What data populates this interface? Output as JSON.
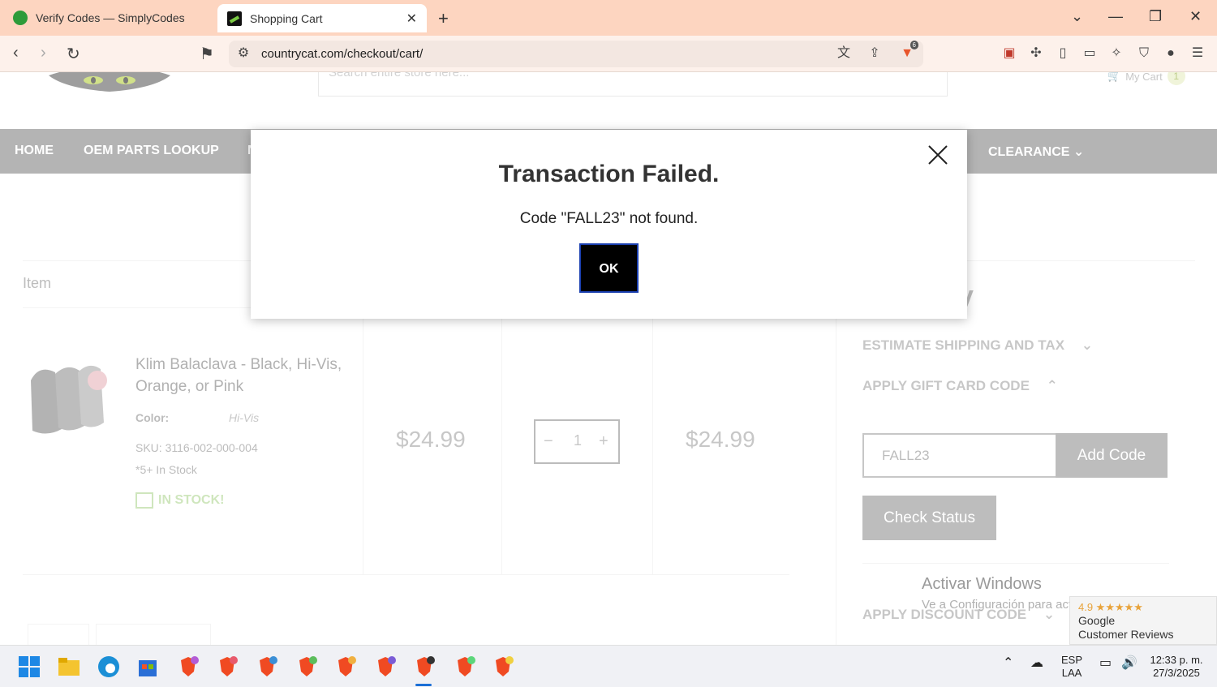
{
  "browser": {
    "tabs": [
      {
        "title": "Verify Codes — SimplyCodes",
        "active": false
      },
      {
        "title": "Shopping Cart",
        "active": true
      }
    ],
    "url": "countrycat.com/checkout/cart/",
    "brave_badge": "6"
  },
  "header": {
    "search_placeholder": "Search entire store here...",
    "cart_label": "My Cart",
    "cart_count": "1"
  },
  "nav": {
    "items": [
      "HOME",
      "OEM PARTS LOOKUP",
      "N",
      "CLEARANCE"
    ]
  },
  "cart": {
    "item_header": "Item",
    "product": {
      "name": "Klim Balaclava - Black, Hi-Vis, Orange, or Pink",
      "color_label": "Color:",
      "color_value": "Hi-Vis",
      "sku": "SKU: 3116-002-000-004",
      "stock_text": "*5+ In Stock",
      "badge": "IN STOCK!",
      "price": "$24.99",
      "quantity": "1",
      "subtotal": "$24.99",
      "qty_minus": "−",
      "qty_plus": "+"
    }
  },
  "summary": {
    "title_fragment": "y",
    "estimate_shipping": "ESTIMATE SHIPPING AND TAX",
    "gift_card": "APPLY GIFT CARD CODE",
    "gift_code_value": "FALL23",
    "add_code": "Add Code",
    "check_status": "Check Status",
    "discount": "APPLY DISCOUNT CODE"
  },
  "modal": {
    "title": "Transaction Failed.",
    "message": "Code \"FALL23\" not found.",
    "ok": "OK"
  },
  "windows_watermark": {
    "line1": "Activar Windows",
    "line2": "Ve a Configuración para activar Windows."
  },
  "reviews_widget": {
    "rating": "4.9 ★★★★★",
    "line1": "Google",
    "line2": "Customer Reviews"
  },
  "taskbar": {
    "lang": "ESP",
    "region": "LAA",
    "time": "12:33 p. m.",
    "date": "27/3/2025"
  },
  "colors": {
    "tab_bar": "#fdd5c0",
    "nav_strip": "#8c8c8c",
    "modal_button": "#000000"
  }
}
